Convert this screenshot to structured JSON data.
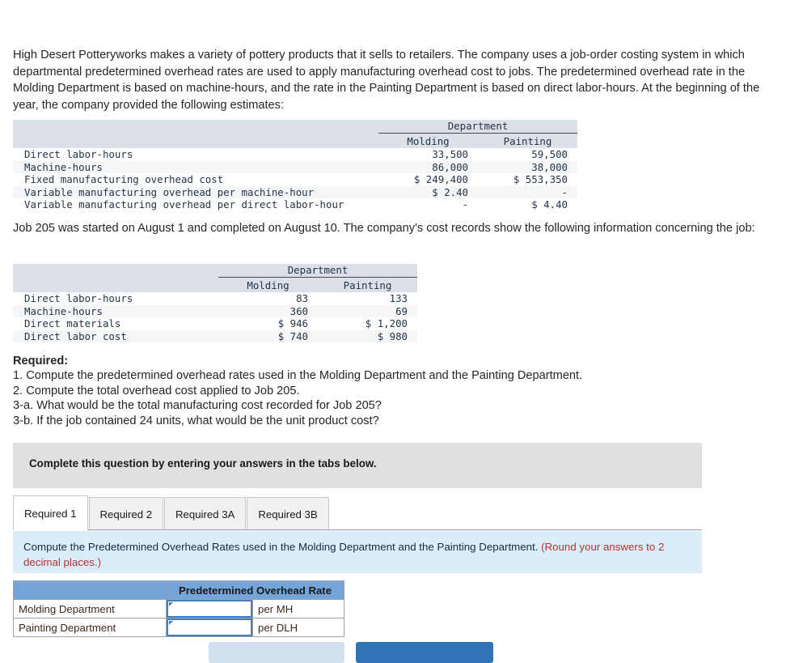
{
  "intro": {
    "paragraph": "High Desert Potteryworks makes a variety of pottery products that it sells to retailers. The company uses a job-order costing system in which departmental predetermined overhead rates are used to apply manufacturing overhead cost to jobs. The predetermined overhead rate in the Molding Department is based on machine-hours, and the rate in the Painting Department is based on direct labor-hours. At the beginning of the year, the company provided the following estimates:",
    "job_paragraph": "Job 205 was started on August 1 and completed on August 10. The company's cost records show the following information concerning the job:"
  },
  "estimates_table": {
    "group_header": "Department",
    "columns": [
      "Molding",
      "Painting"
    ],
    "rows": [
      {
        "label": "Direct labor-hours",
        "molding": "33,500",
        "painting": "59,500"
      },
      {
        "label": "Machine-hours",
        "molding": "86,000",
        "painting": "38,000"
      },
      {
        "label": "Fixed manufacturing overhead cost",
        "molding": "$ 249,400",
        "painting": "$ 553,350"
      },
      {
        "label": "Variable manufacturing overhead per machine-hour",
        "molding": "$ 2.40",
        "painting": "-"
      },
      {
        "label": "Variable manufacturing overhead per direct labor-hour",
        "molding": "-",
        "painting": "$ 4.40"
      }
    ]
  },
  "job_table": {
    "group_header": "Department",
    "columns": [
      "Molding",
      "Painting"
    ],
    "rows": [
      {
        "label": "Direct labor-hours",
        "molding": "83",
        "painting": "133"
      },
      {
        "label": "Machine-hours",
        "molding": "360",
        "painting": "69"
      },
      {
        "label": "Direct materials",
        "molding": "$ 946",
        "painting": "$ 1,200"
      },
      {
        "label": "Direct labor cost",
        "molding": "$ 740",
        "painting": "$ 980"
      }
    ]
  },
  "required": {
    "title": "Required:",
    "items": [
      "1. Compute the predetermined overhead rates used in the Molding Department and the Painting Department.",
      "2. Compute the total overhead cost applied to Job 205.",
      "3-a. What would be the total manufacturing cost recorded for Job 205?",
      "3-b. If the job contained 24 units, what would be the unit product cost?"
    ]
  },
  "instruction_bar": {
    "text": "Complete this question by entering your answers in the tabs below."
  },
  "tabs": [
    {
      "label": "Required 1",
      "active": true
    },
    {
      "label": "Required 2",
      "active": false
    },
    {
      "label": "Required 3A",
      "active": false
    },
    {
      "label": "Required 3B",
      "active": false
    }
  ],
  "question_panel": {
    "text": "Compute the Predetermined Overhead Rates used in the Molding Department and the Painting Department. ",
    "round_note": "(Round your answers to 2 decimal places.)"
  },
  "answer_table": {
    "header_blank": "",
    "header_rate": "Predetermined Overhead Rate",
    "rows": [
      {
        "label": "Molding Department",
        "value": "",
        "unit": "per MH"
      },
      {
        "label": "Painting Department",
        "value": "",
        "unit": "per DLH"
      }
    ]
  },
  "footer": {
    "prev_label": "",
    "next_label": ""
  },
  "colors": {
    "table_header_bg": "#dbe0e9",
    "answer_header_bg": "#74a4d8",
    "question_panel_bg": "#daedfa",
    "instruction_bar_bg": "#e0e0e0",
    "round_note_color": "#b5322e",
    "input_border": "#4a7cb5",
    "btn_prev_bg": "#d3e0ef",
    "btn_next_bg": "#3272b6"
  }
}
